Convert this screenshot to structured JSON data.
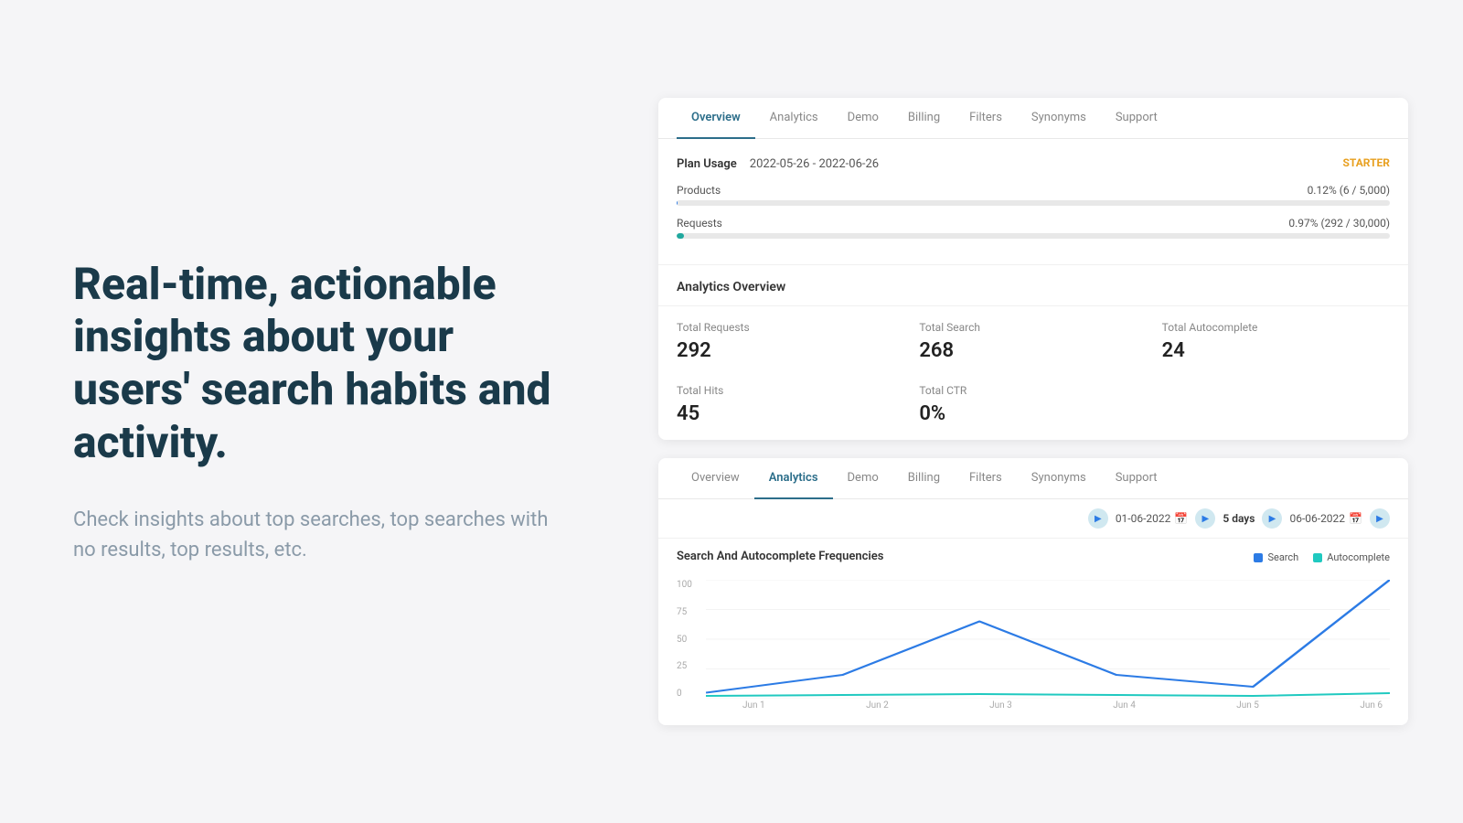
{
  "left": {
    "heading": "Real-time, actionable insights about your users' search habits and activity.",
    "subtext": "Check insights about top searches, top searches with no results, top results, etc."
  },
  "card1": {
    "nav_tabs": [
      {
        "label": "Overview",
        "active": true
      },
      {
        "label": "Analytics",
        "active": false
      },
      {
        "label": "Demo",
        "active": false
      },
      {
        "label": "Billing",
        "active": false
      },
      {
        "label": "Filters",
        "active": false
      },
      {
        "label": "Synonyms",
        "active": false
      },
      {
        "label": "Support",
        "active": false
      }
    ],
    "plan_label": "Plan Usage",
    "plan_date": "2022-05-26 - 2022-06-26",
    "plan_badge": "STARTER",
    "products_label": "Products",
    "products_value": "0.12% (6 / 5,000)",
    "products_pct": 0.12,
    "requests_label": "Requests",
    "requests_value": "0.97% (292 / 30,000)",
    "requests_pct": 0.97,
    "analytics_title": "Analytics Overview",
    "total_requests_label": "Total Requests",
    "total_requests_value": "292",
    "total_search_label": "Total Search",
    "total_search_value": "268",
    "total_autocomplete_label": "Total Autocomplete",
    "total_autocomplete_value": "24",
    "total_hits_label": "Total Hits",
    "total_hits_value": "45",
    "total_ctr_label": "Total CTR",
    "total_ctr_value": "0%"
  },
  "card2": {
    "nav_tabs": [
      {
        "label": "Overview",
        "active": false
      },
      {
        "label": "Analytics",
        "active": true
      },
      {
        "label": "Demo",
        "active": false
      },
      {
        "label": "Billing",
        "active": false
      },
      {
        "label": "Filters",
        "active": false
      },
      {
        "label": "Synonyms",
        "active": false
      },
      {
        "label": "Support",
        "active": false
      }
    ],
    "date_from": "01-06-2022",
    "days_label": "5 days",
    "date_to": "06-06-2022",
    "chart_title": "Search And Autocomplete Frequencies",
    "legend_search": "Search",
    "legend_autocomplete": "Autocomplete",
    "y_labels": [
      "100",
      "75",
      "50",
      "25",
      "0"
    ],
    "x_labels": [
      "Jun 1",
      "Jun 2",
      "Jun 3",
      "Jun 4",
      "Jun 5",
      "Jun 6"
    ]
  }
}
